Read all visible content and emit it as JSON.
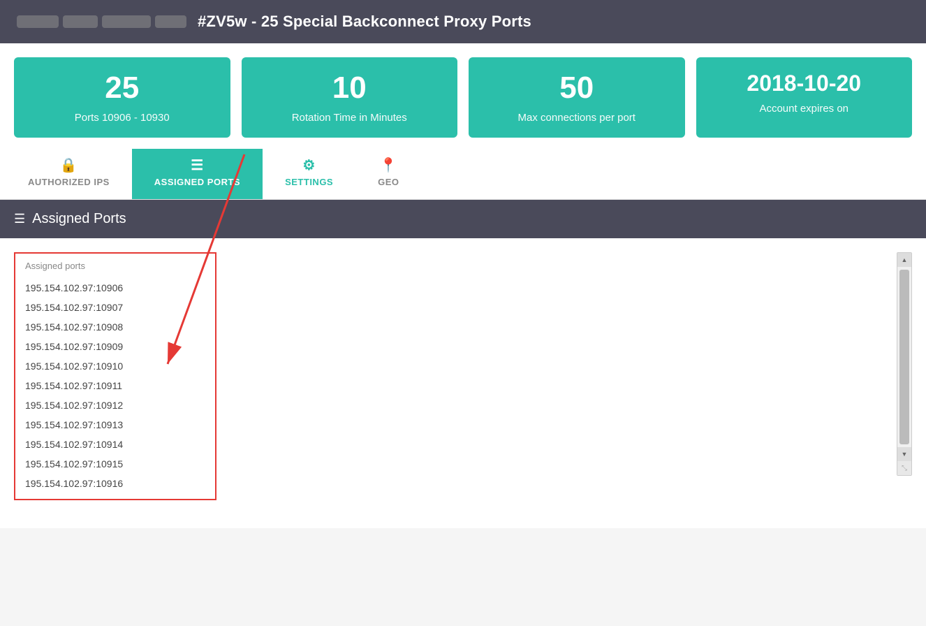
{
  "header": {
    "title": "#ZV5w - 25 Special Backconnect Proxy Ports"
  },
  "stats": [
    {
      "value": "25",
      "label": "Ports 10906 - 10930"
    },
    {
      "value": "10",
      "label": "Rotation Time in Minutes"
    },
    {
      "value": "50",
      "label": "Max connections per port"
    },
    {
      "value": "2018-10-20",
      "label": "Account expires on"
    }
  ],
  "tabs": [
    {
      "id": "authorized-ips",
      "label": "AUTHORIZED IPS",
      "icon": "🔒",
      "active": false
    },
    {
      "id": "assigned-ports",
      "label": "ASSIGNED PORTS",
      "icon": "☰",
      "active": true
    },
    {
      "id": "settings",
      "label": "SETTINGS",
      "icon": "⚙",
      "active": false
    },
    {
      "id": "geo",
      "label": "GEO",
      "icon": "📍",
      "active": false
    }
  ],
  "section": {
    "title": "Assigned Ports",
    "column_label": "Assigned ports"
  },
  "ports": [
    "195.154.102.97:10906",
    "195.154.102.97:10907",
    "195.154.102.97:10908",
    "195.154.102.97:10909",
    "195.154.102.97:10910",
    "195.154.102.97:10911",
    "195.154.102.97:10912",
    "195.154.102.97:10913",
    "195.154.102.97:10914",
    "195.154.102.97:10915",
    "195.154.102.97:10916"
  ]
}
